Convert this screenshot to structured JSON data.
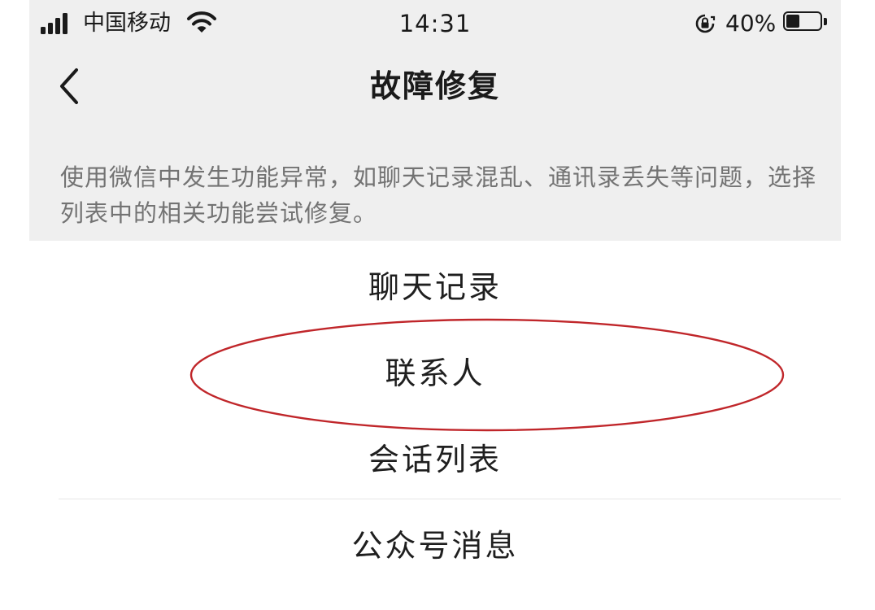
{
  "status_bar": {
    "carrier": "中国移动",
    "time": "14:31",
    "battery_percent_text": "40%",
    "battery_level": 0.4,
    "icons": [
      "signal-icon",
      "wifi-icon",
      "orientation-lock-icon",
      "battery-icon"
    ]
  },
  "nav": {
    "back_icon": "chevron-left-icon",
    "title": "故障修复"
  },
  "description": "使用微信中发生功能异常，如聊天记录混乱、通讯录丢失等问题，选择列表中的相关功能尝试修复。",
  "items": [
    {
      "label": "聊天记录"
    },
    {
      "label": "联系人",
      "highlighted": true
    },
    {
      "label": "会话列表"
    },
    {
      "label": "公众号消息"
    }
  ],
  "colors": {
    "header_bg": "#efefef",
    "list_bg": "#ffffff",
    "description_text": "#737373",
    "highlight_ring": "#c0262a"
  }
}
